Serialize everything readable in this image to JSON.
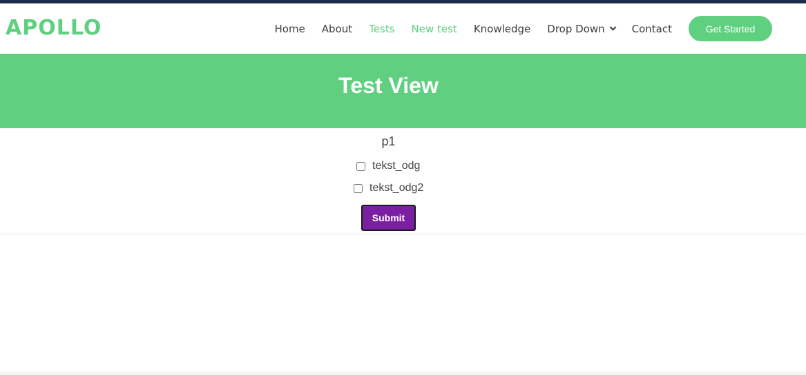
{
  "brand": {
    "logo": "APOLLO"
  },
  "nav": {
    "items": [
      {
        "label": "Home"
      },
      {
        "label": "About"
      },
      {
        "label": "Tests"
      },
      {
        "label": "New test"
      },
      {
        "label": "Knowledge"
      },
      {
        "label": "Drop Down"
      },
      {
        "label": "Contact"
      }
    ],
    "cta_label": "Get Started"
  },
  "hero": {
    "title": "Test View"
  },
  "test": {
    "question": "p1",
    "options": [
      {
        "label": "tekst_odg",
        "checked": false
      },
      {
        "label": "tekst_odg2",
        "checked": false
      }
    ],
    "submit_label": "Submit"
  },
  "colors": {
    "accent": "#5fd07f",
    "hero_bg": "#60d080",
    "submit_bg": "#7b1fa2",
    "topbar": "#1b2a4a"
  }
}
